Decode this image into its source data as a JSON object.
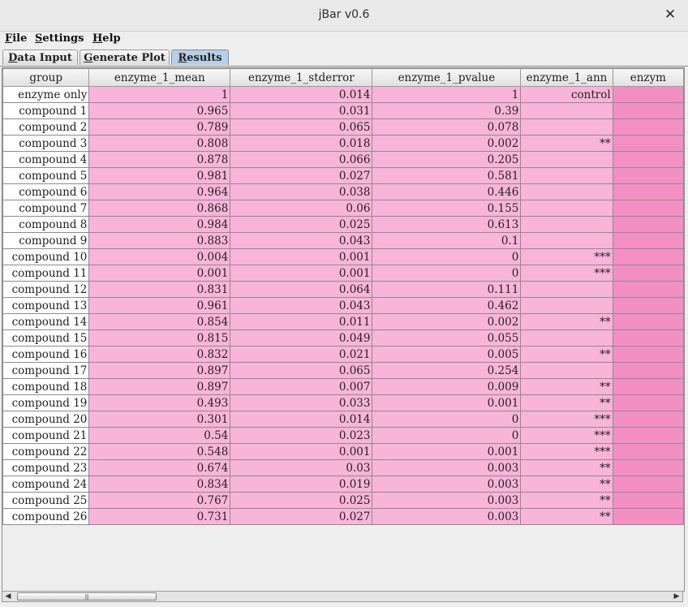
{
  "window": {
    "title": "jBar v0.6",
    "close_glyph": "✕"
  },
  "menu": [
    {
      "mnemonic": "F",
      "rest": "ile"
    },
    {
      "mnemonic": "S",
      "rest": "ettings"
    },
    {
      "mnemonic": "H",
      "rest": "elp"
    }
  ],
  "tabs": [
    {
      "mnemonic": "D",
      "rest": "ata Input",
      "active": false
    },
    {
      "mnemonic": "G",
      "rest": "enerate Plot",
      "active": false
    },
    {
      "mnemonic": "R",
      "rest": "esults",
      "active": true
    }
  ],
  "table": {
    "headers": [
      "group",
      "enzyme_1_mean",
      "enzyme_1_stderror",
      "enzyme_1_pvalue",
      "enzyme_1_ann",
      "enzym"
    ],
    "rows": [
      [
        "enzyme only",
        "1",
        "0.014",
        "1",
        "control"
      ],
      [
        "compound 1",
        "0.965",
        "0.031",
        "0.39",
        ""
      ],
      [
        "compound 2",
        "0.789",
        "0.065",
        "0.078",
        ""
      ],
      [
        "compound 3",
        "0.808",
        "0.018",
        "0.002",
        "**"
      ],
      [
        "compound 4",
        "0.878",
        "0.066",
        "0.205",
        ""
      ],
      [
        "compound 5",
        "0.981",
        "0.027",
        "0.581",
        ""
      ],
      [
        "compound 6",
        "0.964",
        "0.038",
        "0.446",
        ""
      ],
      [
        "compound 7",
        "0.868",
        "0.06",
        "0.155",
        ""
      ],
      [
        "compound 8",
        "0.984",
        "0.025",
        "0.613",
        ""
      ],
      [
        "compound 9",
        "0.883",
        "0.043",
        "0.1",
        ""
      ],
      [
        "compound 10",
        "0.004",
        "0.001",
        "0",
        "***"
      ],
      [
        "compound 11",
        "0.001",
        "0.001",
        "0",
        "***"
      ],
      [
        "compound 12",
        "0.831",
        "0.064",
        "0.111",
        ""
      ],
      [
        "compound 13",
        "0.961",
        "0.043",
        "0.462",
        ""
      ],
      [
        "compound 14",
        "0.854",
        "0.011",
        "0.002",
        "**"
      ],
      [
        "compound 15",
        "0.815",
        "0.049",
        "0.055",
        ""
      ],
      [
        "compound 16",
        "0.832",
        "0.021",
        "0.005",
        "**"
      ],
      [
        "compound 17",
        "0.897",
        "0.065",
        "0.254",
        ""
      ],
      [
        "compound 18",
        "0.897",
        "0.007",
        "0.009",
        "**"
      ],
      [
        "compound 19",
        "0.493",
        "0.033",
        "0.001",
        "**"
      ],
      [
        "compound 20",
        "0.301",
        "0.014",
        "0",
        "***"
      ],
      [
        "compound 21",
        "0.54",
        "0.023",
        "0",
        "***"
      ],
      [
        "compound 22",
        "0.548",
        "0.001",
        "0.001",
        "***"
      ],
      [
        "compound 23",
        "0.674",
        "0.03",
        "0.003",
        "**"
      ],
      [
        "compound 24",
        "0.834",
        "0.019",
        "0.003",
        "**"
      ],
      [
        "compound 25",
        "0.767",
        "0.025",
        "0.003",
        "**"
      ],
      [
        "compound 26",
        "0.731",
        "0.027",
        "0.003",
        "**"
      ]
    ]
  },
  "scrollbar": {
    "left_arrow": "◀",
    "right_arrow": "▶",
    "grip": "|||"
  },
  "colors": {
    "cell": "#f9b4da",
    "extra_column": "#f48fc4",
    "group_cell": "#ffffff",
    "active_tab": "#b8cfe5"
  }
}
